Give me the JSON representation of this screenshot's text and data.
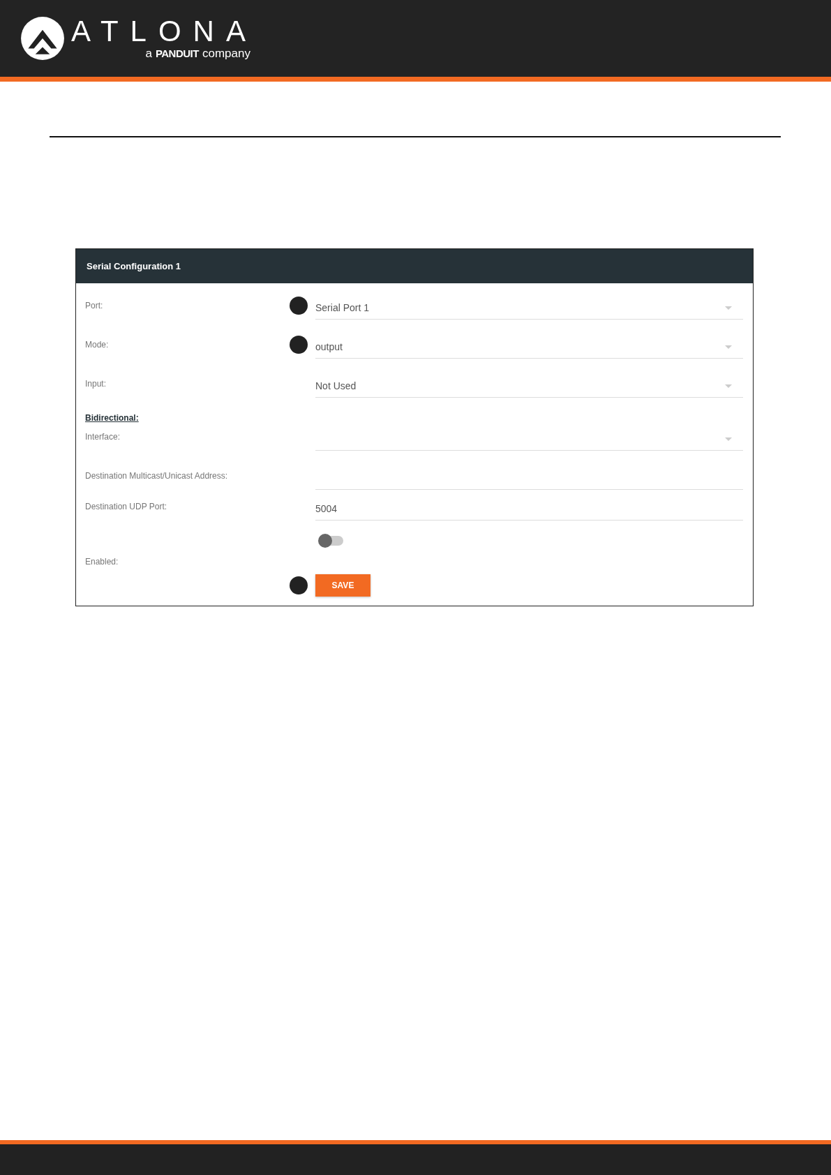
{
  "header": {
    "logo": {
      "wordmark": "ATLONA",
      "tagline_prefix": "a",
      "tagline_brand": "PANDUIT",
      "tagline_suffix": "company"
    }
  },
  "panel": {
    "title": "Serial Configuration 1",
    "rows": [
      {
        "kind": "dropdown",
        "label": "Port:",
        "value": "Serial Port 1",
        "callout": true
      },
      {
        "kind": "dropdown",
        "label": "Mode:",
        "value": "output",
        "callout": true
      },
      {
        "kind": "dropdown",
        "label": "Input:",
        "value": "Not Used",
        "callout": false
      },
      {
        "kind": "heading",
        "label": "Bidirectional:"
      },
      {
        "kind": "dropdown",
        "label": "Interface:",
        "callout": false
      },
      {
        "kind": "text",
        "label": "Destination Multicast/Unicast Address:",
        "callout": false
      },
      {
        "kind": "text",
        "label": "Destination UDP Port:",
        "value": "5004",
        "callout": false
      },
      {
        "kind": "toggle",
        "label": "Enabled:",
        "on": false
      },
      {
        "kind": "button",
        "label": "SAVE",
        "callout": true
      }
    ]
  }
}
